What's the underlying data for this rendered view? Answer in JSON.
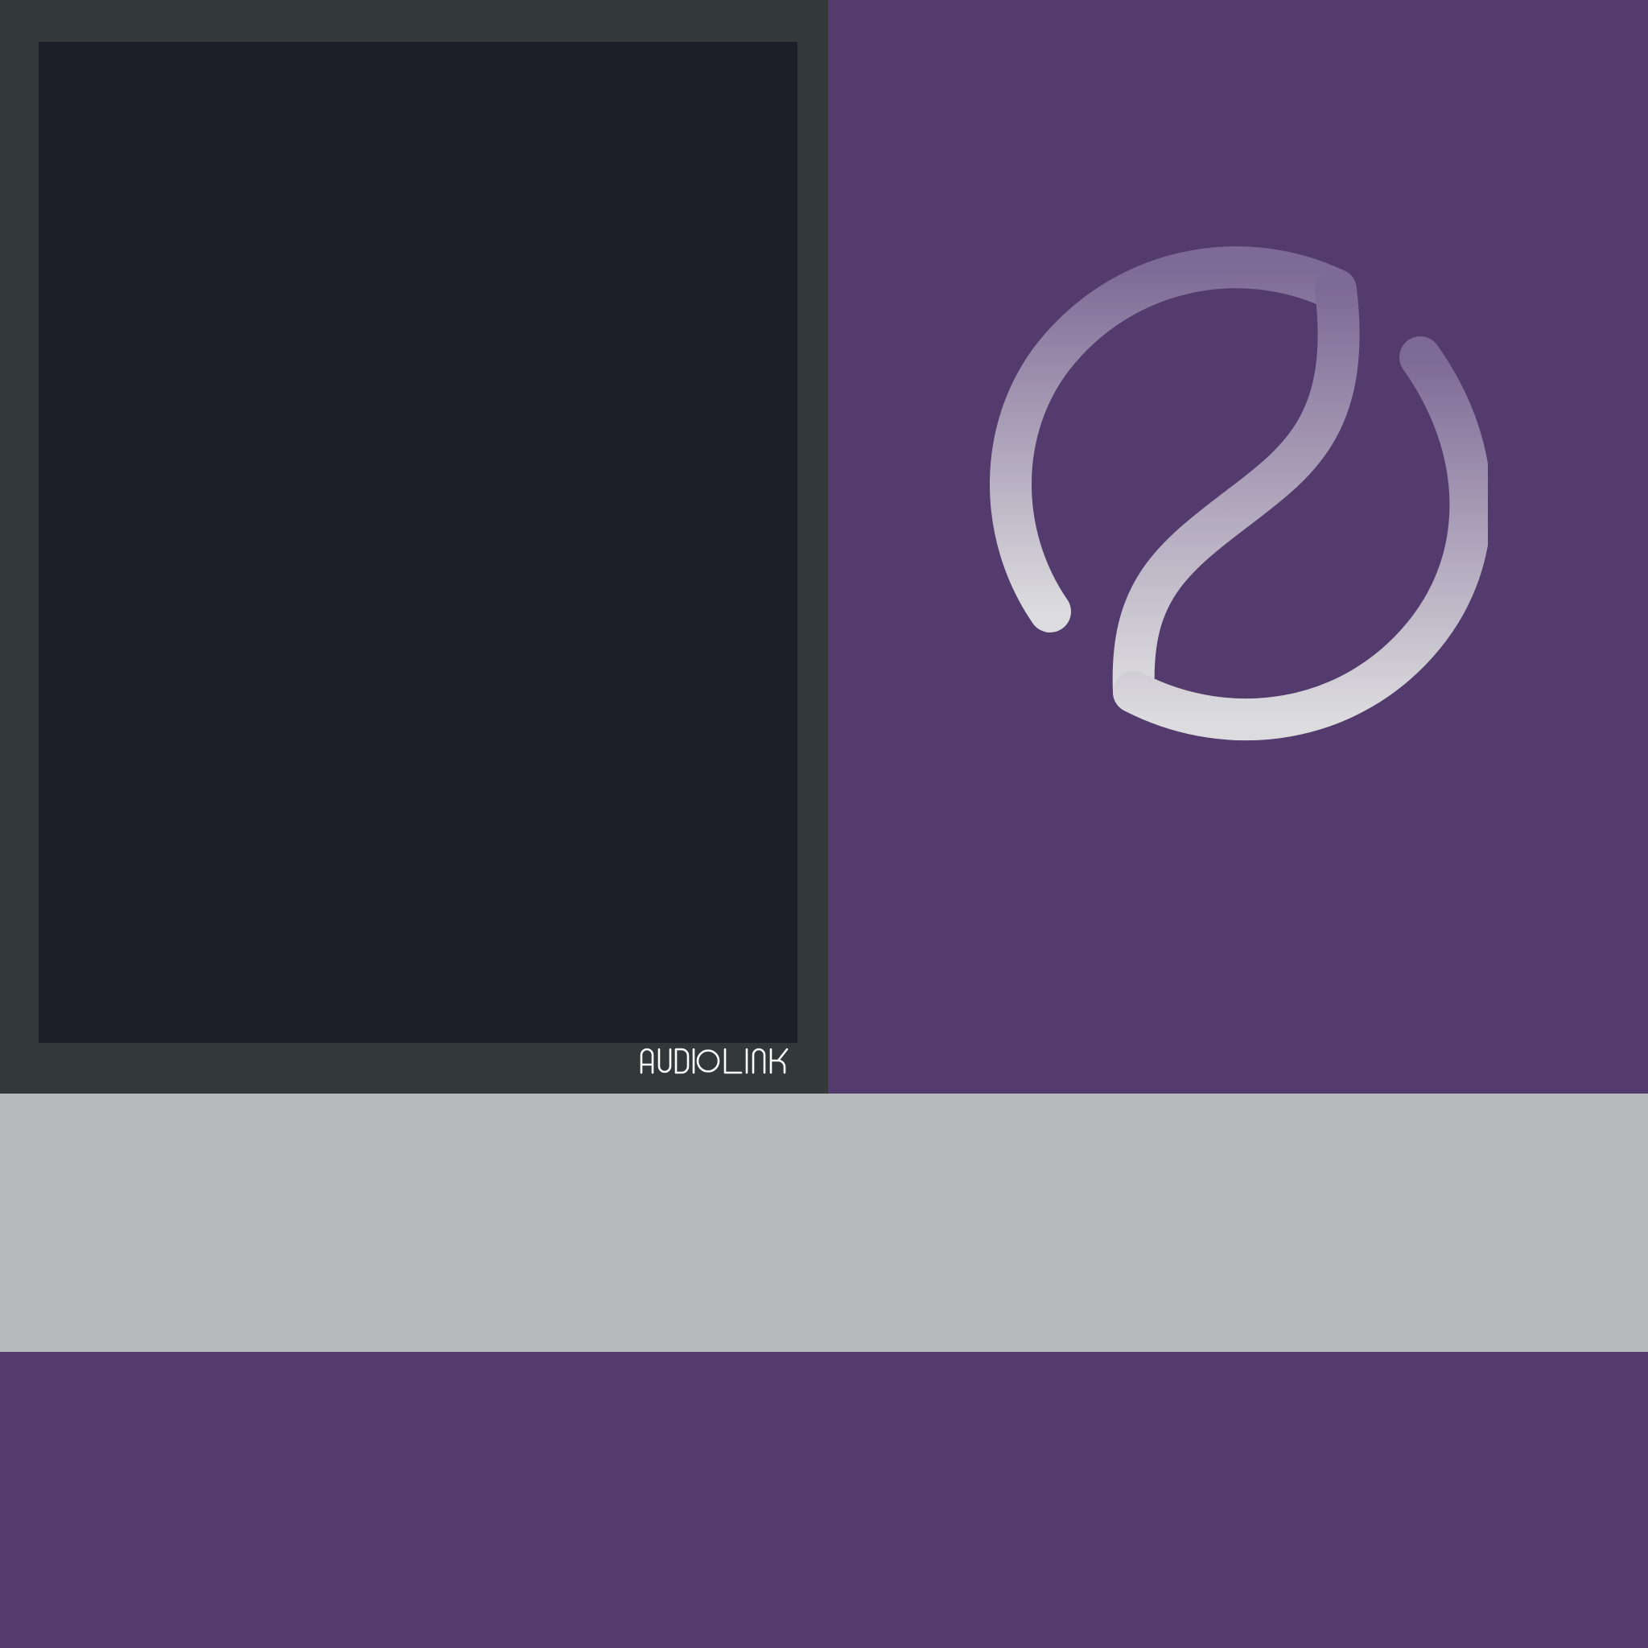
{
  "brand": {
    "wordmark": "AUDIOLINK",
    "logo_icon": "audiolink-logo-icon"
  },
  "colors": {
    "frame": "#333839",
    "display": "#1c1f27",
    "panel": "#533b6e",
    "band": "#b8b9bb",
    "logo_gradient_top": "#7e6a96",
    "logo_gradient_bottom": "#dcdcde",
    "wordmark": "#ffffff"
  }
}
